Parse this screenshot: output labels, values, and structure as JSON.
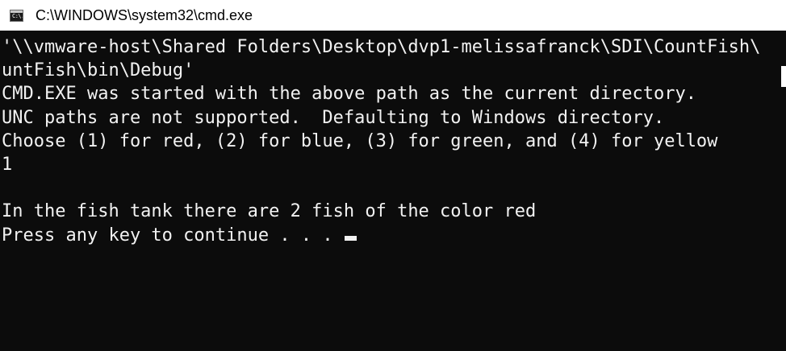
{
  "window": {
    "title": "C:\\WINDOWS\\system32\\cmd.exe",
    "icon": "cmd-icon",
    "icon_glyph": "C:\\."
  },
  "console": {
    "background": "#0c0c0c",
    "foreground": "#f2f2f2",
    "lines": [
      "'\\\\vmware-host\\Shared Folders\\Desktop\\dvp1-melissafranck\\SDI\\CountFish\\",
      "untFish\\bin\\Debug'",
      "CMD.EXE was started with the above path as the current directory.",
      "UNC paths are not supported.  Defaulting to Windows directory.",
      "Choose (1) for red, (2) for blue, (3) for green, and (4) for yellow",
      "1",
      "",
      "In the fish tank there are 2 fish of the color red",
      "Press any key to continue . . . "
    ]
  }
}
